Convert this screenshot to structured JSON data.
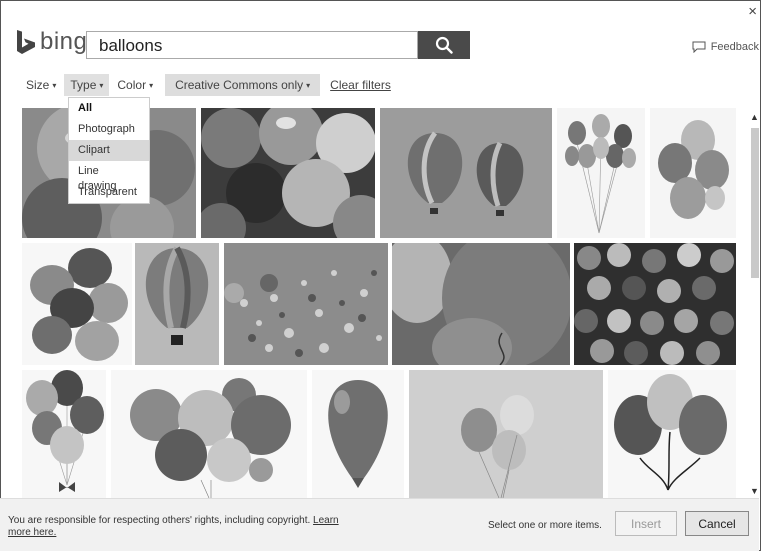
{
  "window": {
    "close_glyph": "×"
  },
  "logo": {
    "word": "bing",
    "icon": "bing-b-logo"
  },
  "search": {
    "value": "balloons",
    "icon": "search-icon"
  },
  "feedback": {
    "label": "Feedback",
    "icon": "speech-bubble-icon"
  },
  "filters": {
    "size": "Size",
    "type": "Type",
    "color": "Color",
    "creative_commons": "Creative Commons only",
    "clear": "Clear filters",
    "caret": "▾"
  },
  "type_menu": [
    "All",
    "Photograph",
    "Clipart",
    "Line drawing",
    "Transparent"
  ],
  "footer": {
    "notice": "You are responsible for respecting others' rights, including copyright.",
    "notice_link_a": "Learn",
    "notice_link_b": "more here.",
    "select_msg": "Select one or more items.",
    "insert": "Insert",
    "cancel": "Cancel"
  },
  "scrollbar": {
    "up": "▲",
    "down": "▼"
  }
}
